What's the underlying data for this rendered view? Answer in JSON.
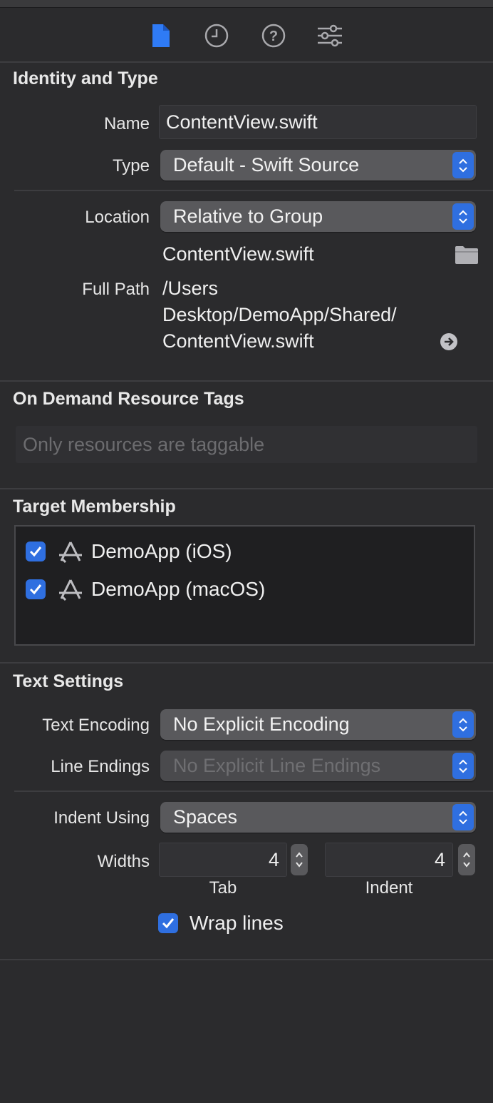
{
  "tabs": {
    "icons": [
      "file-icon",
      "clock-icon",
      "help-icon",
      "sliders-icon"
    ],
    "active_color": "#2f7bf6"
  },
  "identity": {
    "title": "Identity and Type",
    "name_label": "Name",
    "name_value": "ContentView.swift",
    "type_label": "Type",
    "type_value": "Default - Swift Source",
    "location_label": "Location",
    "location_value": "Relative to Group",
    "location_file": "ContentView.swift",
    "fullpath_label": "Full Path",
    "fullpath_line1": "/Users",
    "fullpath_line2": "Desktop/DemoApp/Shared/",
    "fullpath_line3": "ContentView.swift"
  },
  "odr": {
    "title": "On Demand Resource Tags",
    "placeholder": "Only resources are taggable"
  },
  "membership": {
    "title": "Target Membership",
    "items": [
      {
        "label": "DemoApp (iOS)",
        "checked": true
      },
      {
        "label": "DemoApp (macOS)",
        "checked": true
      }
    ]
  },
  "text_settings": {
    "title": "Text Settings",
    "encoding_label": "Text Encoding",
    "encoding_value": "No Explicit Encoding",
    "line_endings_label": "Line Endings",
    "line_endings_value": "No Explicit Line Endings",
    "indent_label": "Indent Using",
    "indent_value": "Spaces",
    "widths_label": "Widths",
    "tab_width": "4",
    "tab_caption": "Tab",
    "indent_width": "4",
    "indent_caption": "Indent",
    "wrap_label": "Wrap lines",
    "wrap_checked": true
  }
}
